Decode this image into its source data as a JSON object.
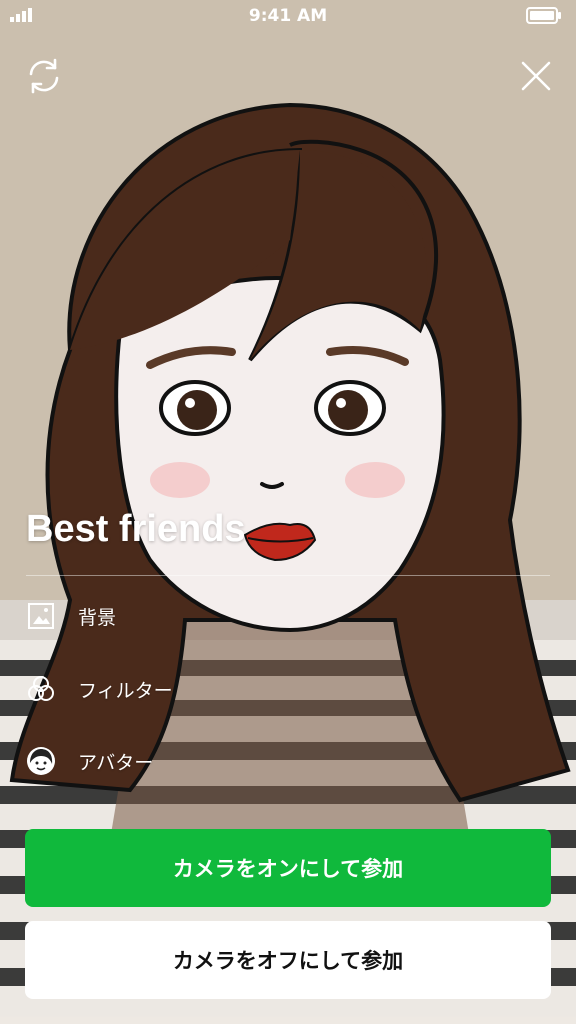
{
  "status_bar": {
    "time": "9:41 AM"
  },
  "preview": {
    "title": "Best friends"
  },
  "options": [
    {
      "label": "背景",
      "icon": "image-icon"
    },
    {
      "label": "フィルター",
      "icon": "filter-circles-icon"
    },
    {
      "label": "アバター",
      "icon": "avatar-face-icon"
    }
  ],
  "actions": {
    "join_camera_on": "カメラをオンにして参加",
    "join_camera_off": "カメラをオフにして参加"
  },
  "colors": {
    "primary_green": "#10b93c",
    "secondary_bg": "#ffffff"
  }
}
